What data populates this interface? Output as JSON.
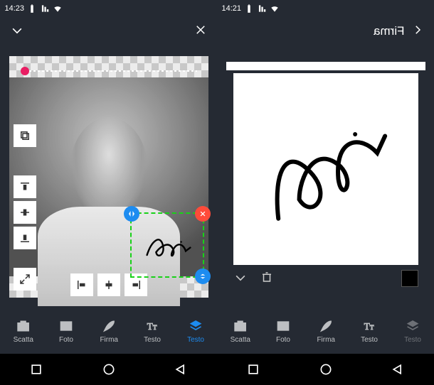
{
  "left": {
    "status": {
      "time": "14:23"
    },
    "toolbar": {
      "items": [
        {
          "name": "layers",
          "label": "Testo",
          "active": true
        },
        {
          "name": "text",
          "label": "Testo"
        },
        {
          "name": "signature",
          "label": "Firma"
        },
        {
          "name": "photo",
          "label": "Foto"
        },
        {
          "name": "camera",
          "label": "Scatta"
        }
      ]
    },
    "floating_tools": {
      "duplicate": "duplicate",
      "align_top": "align-top",
      "align_vcenter": "align-vcenter",
      "align_bottom": "align-bottom",
      "collapse": "collapse",
      "align_left": "align-left",
      "align_hcenter": "align-hcenter",
      "align_right": "align-right"
    },
    "selection": {
      "content": "signature-overlay",
      "handles": {
        "move": "move",
        "delete": "delete",
        "resize": "resize"
      }
    }
  },
  "right": {
    "status": {
      "time": "14:21"
    },
    "header": {
      "title": "Firma"
    },
    "signature_tools": {
      "undo": "undo",
      "delete": "delete",
      "color": "#000000"
    },
    "toolbar": {
      "items": [
        {
          "name": "layers",
          "label": "Testo"
        },
        {
          "name": "text",
          "label": "Testo"
        },
        {
          "name": "signature",
          "label": "Firma"
        },
        {
          "name": "photo",
          "label": "Foto"
        },
        {
          "name": "camera",
          "label": "Scatta"
        }
      ]
    }
  },
  "nav": {
    "back": "back",
    "home": "home",
    "recent": "recent"
  }
}
